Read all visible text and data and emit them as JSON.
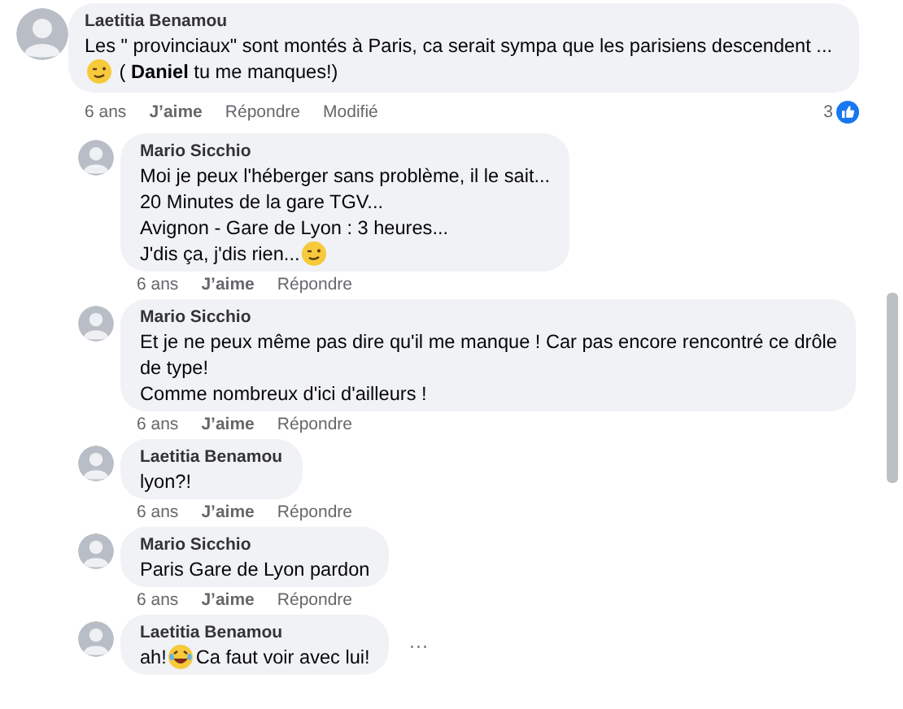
{
  "comment": {
    "author": "Laetitia Benamou",
    "lines": [
      [
        {
          "kind": "text",
          "text": "Les \" provinciaux\" sont montés à Paris, ca serait sympa que les parisiens descendent ..."
        }
      ],
      [
        {
          "kind": "wink-emoji"
        },
        {
          "kind": "text",
          "text": " ( **Daniel** tu me manques!)"
        }
      ]
    ],
    "time": "6 ans",
    "like": "J’aime",
    "reply": "Répondre",
    "edited": "Modifié",
    "reaction_count": "3"
  },
  "replies": [
    {
      "author": "Mario Sicchio",
      "lines": [
        [
          {
            "kind": "text",
            "text": "Moi je peux l'héberger sans problème, il le sait..."
          }
        ],
        [
          {
            "kind": "text",
            "text": "20 Minutes de la gare TGV..."
          }
        ],
        [
          {
            "kind": "text",
            "text": "Avignon - Gare de Lyon : 3 heures..."
          }
        ],
        [
          {
            "kind": "text",
            "text": "J'dis ça, j'dis rien..."
          },
          {
            "kind": "wink-emoji"
          }
        ]
      ],
      "time": "6 ans",
      "like": "J’aime",
      "reply": "Répondre"
    },
    {
      "author": "Mario Sicchio",
      "lines": [
        [
          {
            "kind": "text",
            "text": "Et je ne peux même pas dire qu'il me manque ! Car pas encore rencontré ce drôle"
          }
        ],
        [
          {
            "kind": "text",
            "text": "de type!"
          }
        ],
        [
          {
            "kind": "text",
            "text": "Comme nombreux d'ici d'ailleurs !"
          }
        ]
      ],
      "time": "6 ans",
      "like": "J’aime",
      "reply": "Répondre"
    },
    {
      "author": "Laetitia Benamou",
      "lines": [
        [
          {
            "kind": "text",
            "text": "lyon?!"
          }
        ]
      ],
      "time": "6 ans",
      "like": "J’aime",
      "reply": "Répondre"
    },
    {
      "author": "Mario Sicchio",
      "lines": [
        [
          {
            "kind": "text",
            "text": "Paris Gare de Lyon pardon"
          }
        ]
      ],
      "time": "6 ans",
      "like": "J’aime",
      "reply": "Répondre"
    },
    {
      "author": "Laetitia Benamou",
      "lines": [
        [
          {
            "kind": "text",
            "text": "ah!"
          },
          {
            "kind": "laugh-emoji"
          },
          {
            "kind": "text",
            "text": "Ca faut voir avec lui!"
          }
        ]
      ],
      "more": "···"
    }
  ]
}
